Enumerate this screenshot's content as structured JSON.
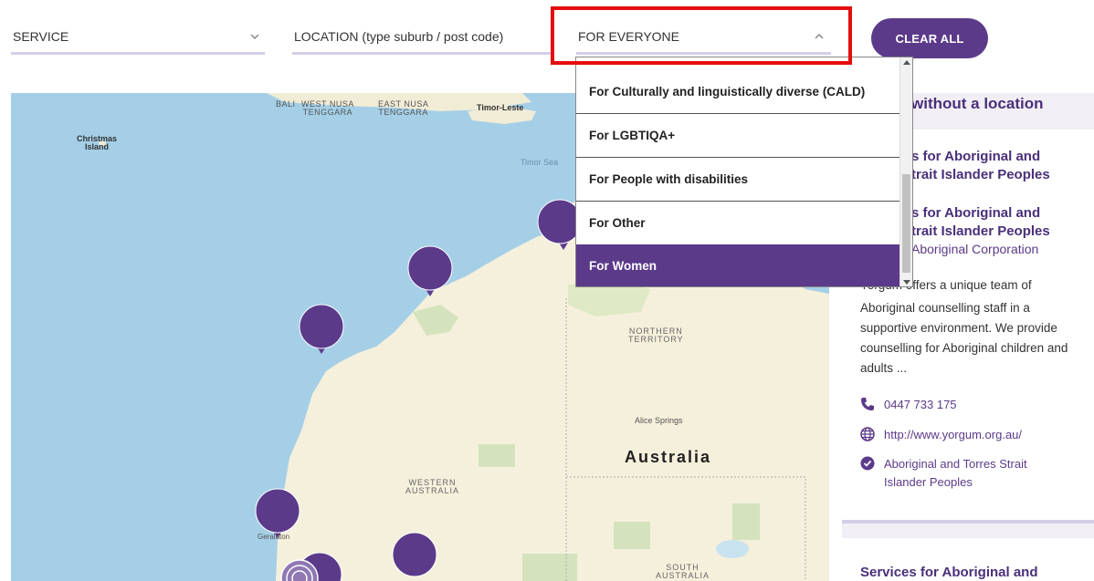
{
  "filters": {
    "service": {
      "label": "SERVICE"
    },
    "location": {
      "placeholder": "LOCATION (type suburb / post code)"
    },
    "audience": {
      "label": "FOR EVERYONE"
    }
  },
  "clear_all_label": "CLEAR ALL",
  "dropdown": {
    "options": [
      "For Culturally and linguistically diverse (CALD)",
      "For LGBTIQA+",
      "For People with disabilities",
      "For Other",
      "For Women"
    ],
    "selected": "For Women"
  },
  "map": {
    "labels": {
      "bali": "BALI",
      "west_nusa": "WEST NUSA\nTENGGARA",
      "east_nusa": "EAST NUSA\nTENGGARA",
      "timor_leste": "Timor-Leste",
      "christmas_island": "Christmas\nIsland",
      "timor_sea": "Timor Sea",
      "northern_territory": "NORTHERN\nTERRITORY",
      "alice_springs": "Alice Springs",
      "australia": "Australia",
      "western_australia": "WESTERN\nAUSTRALIA",
      "geraldton": "Geraldton",
      "south_australia": "SOUTH\nAUSTRALIA"
    }
  },
  "panel": {
    "heading": "without a location",
    "card1": {
      "title_line1": "s for Aboriginal and",
      "title_line2": "trait Islander Peoples",
      "title2_line1": "s for Aboriginal and",
      "title2_line2": "trait Islander Peoples",
      "org": "Aboriginal Corporation",
      "desc_start": "offers a unique team of",
      "description": "Aboriginal counselling staff in a supportive environment. We provide counselling for Aboriginal children and adults ...",
      "phone": "0447 733 175",
      "website": "http://www.yorgum.org.au/",
      "audience_line1": "Aboriginal and Torres Strait",
      "audience_line2": "Islander Peoples"
    },
    "card2": {
      "title": "Services for Aboriginal and"
    }
  },
  "colors": {
    "brand_purple": "#5b3a8a",
    "highlight_red": "#e50d0d",
    "water": "#a4cfe7",
    "land": "#f5f0dc"
  }
}
